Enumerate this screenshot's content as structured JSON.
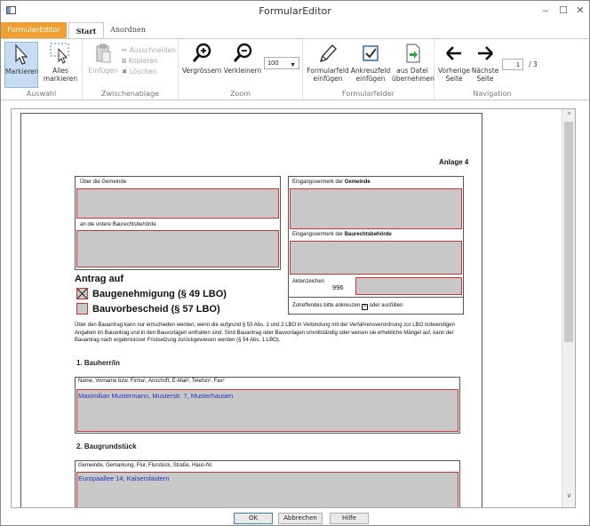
{
  "window": {
    "title": "FormularEditor",
    "minimize": "–",
    "maximize": "☐",
    "close": "✕"
  },
  "tabs": {
    "app": "FormularEditor",
    "start": "Start",
    "arrange": "Anordnen"
  },
  "ribbon": {
    "auswahl": {
      "label": "Auswahl",
      "markieren": "Markieren",
      "alles_markieren_1": "Alles",
      "alles_markieren_2": "markieren"
    },
    "zwischenablage": {
      "label": "Zwischenablage",
      "einfuegen": "Einfügen",
      "ausschneiden": "Ausschneiden",
      "kopieren": "Kopieren",
      "loeschen": "Löschen"
    },
    "zoom": {
      "label": "Zoom",
      "vergroessern": "Vergrössern",
      "verkleinern": "Verkleinern",
      "value": "100"
    },
    "formularfelder": {
      "label": "Formularfelder",
      "formularfeld_1": "Formularfeld",
      "formularfeld_2": "einfügen",
      "ankreuzfeld_1": "Ankreuzfeld",
      "ankreuzfeld_2": "einfügen",
      "ausdatei_1": "aus Datei",
      "ausdatei_2": "übernehmen"
    },
    "navigation": {
      "label": "Navigation",
      "vorherige_1": "Vorherige",
      "vorherige_2": "Seite",
      "naechste_1": "Nächste",
      "naechste_2": "Seite",
      "page": "1",
      "total": "/ 3"
    }
  },
  "document": {
    "anlage": "Anlage 4",
    "gemeinde_label": "Über die Gemeinde",
    "baurecht_label": "an die untere Baurechtsbehörde",
    "eingang_gemeinde_pre": "Eingangsvermerk der ",
    "eingang_gemeinde_bold": "Gemeinde",
    "eingang_baurecht_pre": "Eingangsvermerk der ",
    "eingang_baurecht_bold": "Baurechtsbehörde",
    "aktenzeichen_label": "Aktenzeichen",
    "aktenzeichen_value": "996",
    "zutreffendes": "Zutreffendes bitte ankreuzen",
    "oder_ausfuellen": "oder ausfüllen",
    "antrag_auf": "Antrag auf",
    "baugenehmigung": "Baugenehmigung (§ 49 LBO)",
    "bauvorbescheid": "Bauvorbescheid (§ 57 LBO)",
    "paragraph": "Über den Bauantrag kann nur entschieden werden, wenn die aufgrund § 53 Abs. 1 und 2 LBO in Verbindung mit der Verfahrensverordnung zur LBO notwendigen Angaben im Bauantrag und in den Bauvorlagen enthalten sind. Sind Bauantrag oder Bauvorlagen unvollständig oder weisen sie erhebliche Mängel auf, kann der Bauantrag nach ergebnisloser Fristsetzung zurückgewiesen werden (§ 54 Abs. 1 LBO).",
    "sec1": "1.   Bauherr/in",
    "sec1_label": "Name, Vorname bzw. Firma¹, Anschrift, E-Mail², Telefon², Fax²",
    "sec1_value": "Maximilian Mustermann, Musterstr. 7, Musterhausen",
    "sec2": "2.   Baugrundstück",
    "sec2_label": "Gemeinde, Gemarkung, Flur, Flurstück, Straße, Haus-Nr.",
    "sec2_value": "Europaallee 14, Kaiserslautern"
  },
  "footer": {
    "ok": "OK",
    "abbrechen": "Abbrechen",
    "hilfe": "Hilfe"
  },
  "colors": {
    "accent": "#f0a030",
    "field_fill": "#c8c8c8",
    "field_border": "#cc3333",
    "value_text": "#2233bb"
  }
}
